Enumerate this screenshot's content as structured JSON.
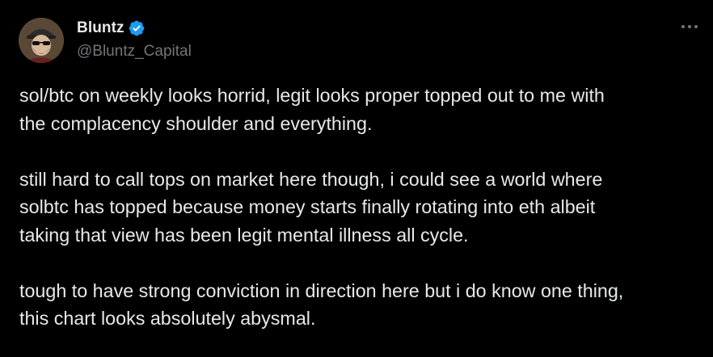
{
  "author": {
    "display_name": "Bluntz",
    "handle": "@Bluntz_Capital",
    "verified": true,
    "avatar_icon": "profile-avatar",
    "verified_icon": "verified-badge-icon",
    "verified_color": "#1d9bf0"
  },
  "menu": {
    "icon": "more-options-icon"
  },
  "tweet": {
    "paragraphs": [
      "sol/btc on weekly looks horrid, legit looks proper topped out to me with\nthe complacency shoulder and everything.",
      "still hard to call tops on market here though, i could see a world where\nsolbtc has topped because money starts finally rotating into eth albeit\ntaking that view has been legit mental illness all cycle.",
      "tough to have strong conviction in direction here but i do know one thing,\nthis chart looks absolutely abysmal."
    ]
  },
  "colors": {
    "background": "#000000",
    "text_primary": "#e7e9ea",
    "text_secondary": "#71767b"
  }
}
